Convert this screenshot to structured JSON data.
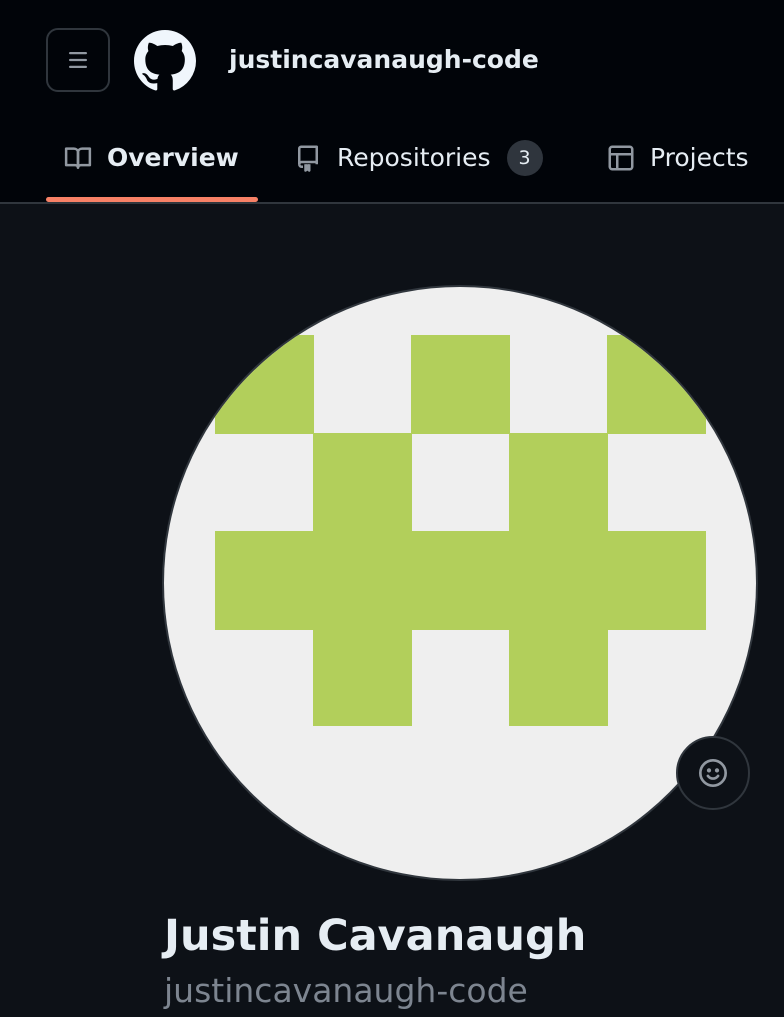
{
  "header": {
    "menu_icon": "three-bars-icon",
    "logo_icon": "github-mark-icon",
    "owner_name": "justincavanaugh-code"
  },
  "nav": {
    "tabs": [
      {
        "label": "Overview",
        "icon": "book-icon",
        "active": true
      },
      {
        "label": "Repositories",
        "icon": "repo-icon",
        "count": "3"
      },
      {
        "label": "Projects",
        "icon": "table-icon"
      }
    ],
    "active_underline_color": "#f78166"
  },
  "profile": {
    "avatar_colors": {
      "background": "#efefef",
      "foreground": "#b2cf5b"
    },
    "status_icon": "smiley-icon",
    "full_name": "Justin Cavanaugh",
    "login": "justincavanaugh-code"
  },
  "colors": {
    "page_background": "#0d1117",
    "header_background": "#010409",
    "text_primary": "#e6edf3",
    "text_muted": "#7d8590",
    "border": "#30363d"
  }
}
